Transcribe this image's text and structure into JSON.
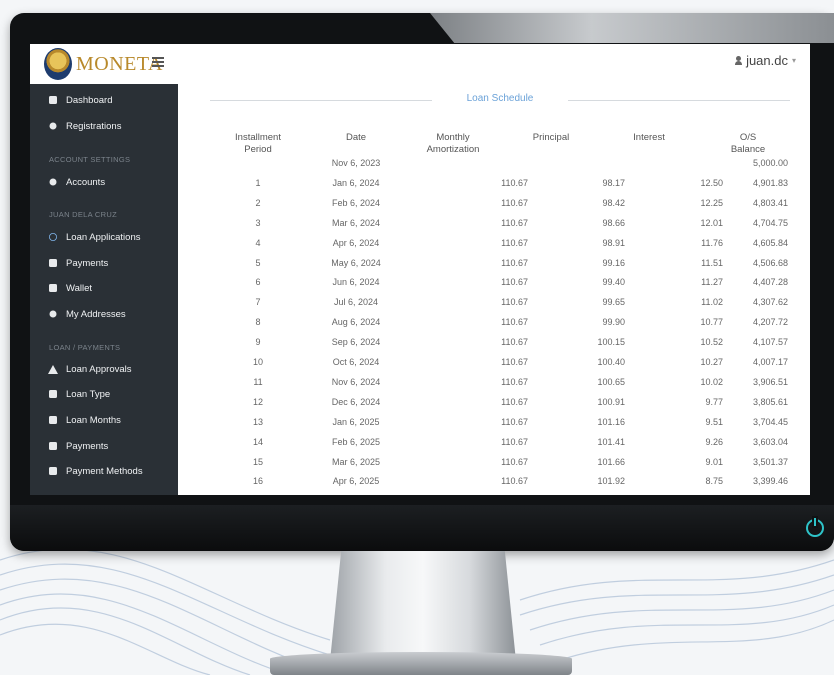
{
  "app": {
    "logo_text": "MONETA",
    "username": "juan.dc"
  },
  "sidebar": {
    "items": [
      {
        "label": "Dashboard",
        "icon": "dashboard-icon"
      },
      {
        "label": "Registrations",
        "icon": "users-icon"
      }
    ],
    "section_account": "ACCOUNT SETTINGS",
    "account_items": [
      {
        "label": "Accounts",
        "icon": "user-icon"
      }
    ],
    "section_user": "JUAN DELA CRUZ",
    "user_items": [
      {
        "label": "Loan Applications",
        "icon": "loading-icon"
      },
      {
        "label": "Payments",
        "icon": "money-icon"
      },
      {
        "label": "Wallet",
        "icon": "wallet-icon"
      },
      {
        "label": "My Addresses",
        "icon": "map-marker-icon"
      }
    ],
    "section_loan": "LOAN / PAYMENTS",
    "loan_items": [
      {
        "label": "Loan Approvals",
        "icon": "gavel-icon"
      },
      {
        "label": "Loan Type",
        "icon": "tag-icon"
      },
      {
        "label": "Loan Months",
        "icon": "calendar-icon"
      },
      {
        "label": "Payments",
        "icon": "money-icon"
      },
      {
        "label": "Payment Methods",
        "icon": "bank-icon"
      }
    ]
  },
  "schedule": {
    "title": "Loan Schedule",
    "headers": {
      "period_1": "Installment",
      "period_2": "Period",
      "date": "Date",
      "amort_1": "Monthly",
      "amort_2": "Amortization",
      "principal": "Principal",
      "interest": "Interest",
      "balance_1": "O/S",
      "balance_2": "Balance"
    },
    "rows": [
      {
        "period": "",
        "date": "Nov 6, 2023",
        "amort": "",
        "principal": "",
        "interest": "",
        "balance": "5,000.00"
      },
      {
        "period": "1",
        "date": "Jan 6, 2024",
        "amort": "110.67",
        "principal": "98.17",
        "interest": "12.50",
        "balance": "4,901.83"
      },
      {
        "period": "2",
        "date": "Feb 6, 2024",
        "amort": "110.67",
        "principal": "98.42",
        "interest": "12.25",
        "balance": "4,803.41"
      },
      {
        "period": "3",
        "date": "Mar 6, 2024",
        "amort": "110.67",
        "principal": "98.66",
        "interest": "12.01",
        "balance": "4,704.75"
      },
      {
        "period": "4",
        "date": "Apr 6, 2024",
        "amort": "110.67",
        "principal": "98.91",
        "interest": "11.76",
        "balance": "4,605.84"
      },
      {
        "period": "5",
        "date": "May 6, 2024",
        "amort": "110.67",
        "principal": "99.16",
        "interest": "11.51",
        "balance": "4,506.68"
      },
      {
        "period": "6",
        "date": "Jun 6, 2024",
        "amort": "110.67",
        "principal": "99.40",
        "interest": "11.27",
        "balance": "4,407.28"
      },
      {
        "period": "7",
        "date": "Jul 6, 2024",
        "amort": "110.67",
        "principal": "99.65",
        "interest": "11.02",
        "balance": "4,307.62"
      },
      {
        "period": "8",
        "date": "Aug 6, 2024",
        "amort": "110.67",
        "principal": "99.90",
        "interest": "10.77",
        "balance": "4,207.72"
      },
      {
        "period": "9",
        "date": "Sep 6, 2024",
        "amort": "110.67",
        "principal": "100.15",
        "interest": "10.52",
        "balance": "4,107.57"
      },
      {
        "period": "10",
        "date": "Oct 6, 2024",
        "amort": "110.67",
        "principal": "100.40",
        "interest": "10.27",
        "balance": "4,007.17"
      },
      {
        "period": "11",
        "date": "Nov 6, 2024",
        "amort": "110.67",
        "principal": "100.65",
        "interest": "10.02",
        "balance": "3,906.51"
      },
      {
        "period": "12",
        "date": "Dec 6, 2024",
        "amort": "110.67",
        "principal": "100.91",
        "interest": "9.77",
        "balance": "3,805.61"
      },
      {
        "period": "13",
        "date": "Jan 6, 2025",
        "amort": "110.67",
        "principal": "101.16",
        "interest": "9.51",
        "balance": "3,704.45"
      },
      {
        "period": "14",
        "date": "Feb 6, 2025",
        "amort": "110.67",
        "principal": "101.41",
        "interest": "9.26",
        "balance": "3,603.04"
      },
      {
        "period": "15",
        "date": "Mar 6, 2025",
        "amort": "110.67",
        "principal": "101.66",
        "interest": "9.01",
        "balance": "3,501.37"
      },
      {
        "period": "16",
        "date": "Apr 6, 2025",
        "amort": "110.67",
        "principal": "101.92",
        "interest": "8.75",
        "balance": "3,399.46"
      }
    ]
  },
  "colors": {
    "sidebar_bg": "#2a3036",
    "accent_blue": "#6ba2d8",
    "logo_gold": "#b8892b",
    "power_teal": "#2ec4c9"
  }
}
